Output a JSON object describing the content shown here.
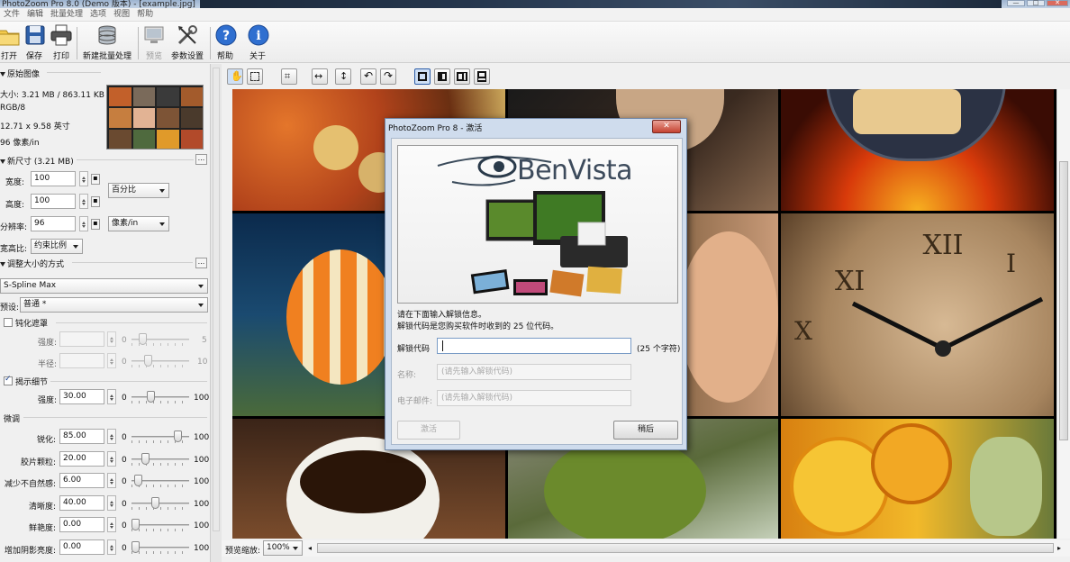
{
  "window": {
    "title": "PhotoZoom Pro 8.0 (Demo 版本) - [example.jpg]"
  },
  "menu": [
    "文件",
    "编辑",
    "批量处理",
    "选项",
    "视图",
    "帮助"
  ],
  "toolbar": {
    "open": "打开",
    "save": "保存",
    "print": "打印",
    "new_batch": "新建批量处理",
    "preview": "预览",
    "settings": "参数设置",
    "help": "帮助",
    "about": "关于"
  },
  "original": {
    "header": "原始图像",
    "size": "大小: 3.21 MB / 863.11 KB",
    "mode": "RGB/8",
    "dimensions": "12.71 x 9.58 英寸",
    "resolution": "96 像素/in"
  },
  "new_size": {
    "header": "新尺寸 (3.21 MB)",
    "width_label": "宽度:",
    "width_value": "100",
    "height_label": "高度:",
    "height_value": "100",
    "unit": "百分比",
    "res_label": "分辨率:",
    "res_value": "96",
    "res_unit": "像素/in",
    "aspect_label": "宽高比:",
    "aspect_value": "约束比例"
  },
  "resize_method": {
    "header": "调整大小的方式",
    "method": "S-Spline Max",
    "preset_label": "预设:",
    "preset_value": "普通 *"
  },
  "unsharp": {
    "label": "钝化遮罩",
    "checked": false,
    "strength_label": "强度:",
    "strength_min": "0",
    "strength_max": "5",
    "radius_label": "半径:",
    "radius_min": "0",
    "radius_max": "10"
  },
  "detail": {
    "label": "揭示细节",
    "checked": true,
    "intensity_label": "强度:",
    "intensity_value": "30.00",
    "min": "0",
    "max": "100",
    "level": 0.3
  },
  "finetune": {
    "header": "微调",
    "rows": [
      {
        "label": "锐化:",
        "value": "85.00",
        "min": "0",
        "max": "100",
        "level": 0.85
      },
      {
        "label": "胶片颗粒:",
        "value": "20.00",
        "min": "0",
        "max": "100",
        "level": 0.2
      },
      {
        "label": "减少不自然感:",
        "value": "6.00",
        "min": "0",
        "max": "100",
        "level": 0.06
      },
      {
        "label": "清晰度:",
        "value": "40.00",
        "min": "0",
        "max": "100",
        "level": 0.4
      },
      {
        "label": "鲜艳度:",
        "value": "0.00",
        "min": "0",
        "max": "100",
        "level": 0.0
      },
      {
        "label": "增加阴影亮度:",
        "value": "0.00",
        "min": "0",
        "max": "100",
        "level": 0.0
      }
    ]
  },
  "status": {
    "zoom_label": "预览缩放:",
    "zoom_value": "100%"
  },
  "dialog": {
    "title": "PhotoZoom Pro 8 - 激活",
    "brand": "BenVista",
    "line1": "请在下面输入解锁信息。",
    "line2": "解锁代码是您购买软件时收到的 25 位代码。",
    "code_label": "解锁代码",
    "code_value": "",
    "code_hint": "(25 个字符)",
    "name_label": "名称:",
    "name_placeholder": "(请先输入解锁代码)",
    "email_label": "电子邮件:",
    "email_placeholder": "(请先输入解锁代码)",
    "activate": "激活",
    "later": "稍后"
  }
}
